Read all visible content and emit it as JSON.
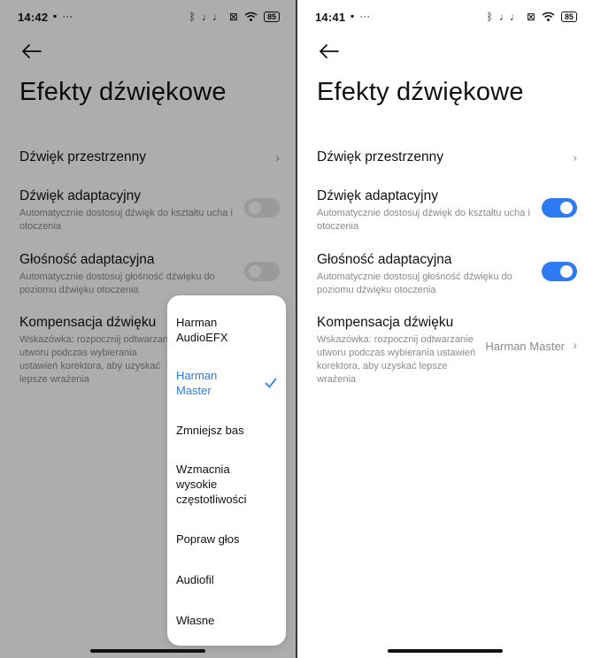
{
  "left": {
    "status": {
      "time": "14:42",
      "battery": "85"
    },
    "title": "Efekty dźwiękowe",
    "rows": {
      "spatial": {
        "title": "Dźwięk przestrzenny"
      },
      "adaptive_sound": {
        "title": "Dźwięk adaptacyjny",
        "desc": "Automatycznie dostosuj dźwięk do kształtu ucha i otoczenia",
        "on": false
      },
      "adaptive_volume": {
        "title": "Głośność adaptacyjna",
        "desc": "Automatycznie dostosuj głośność dźwięku do poziomu dźwięku otoczenia",
        "on": false
      },
      "compensation": {
        "title": "Kompensacja dźwięku",
        "desc": "Wskazówka: rozpocznij odtwarzanie utworu podczas wybierania ustawień korektora, aby uzyskać lepsze wrażenia"
      }
    },
    "menu": {
      "items": [
        {
          "label": "Harman AudioEFX",
          "selected": false
        },
        {
          "label": "Harman Master",
          "selected": true
        },
        {
          "label": "Zmniejsz bas",
          "selected": false
        },
        {
          "label": "Wzmacnia wysokie częstotliwości",
          "selected": false
        },
        {
          "label": "Popraw głos",
          "selected": false
        },
        {
          "label": "Audiofil",
          "selected": false
        },
        {
          "label": "Własne",
          "selected": false
        }
      ]
    }
  },
  "right": {
    "status": {
      "time": "14:41",
      "battery": "85"
    },
    "title": "Efekty dźwiękowe",
    "rows": {
      "spatial": {
        "title": "Dźwięk przestrzenny"
      },
      "adaptive_sound": {
        "title": "Dźwięk adaptacyjny",
        "desc": "Automatycznie dostosuj dźwięk do kształtu ucha i otoczenia",
        "on": true
      },
      "adaptive_volume": {
        "title": "Głośność adaptacyjna",
        "desc": "Automatycznie dostosuj głośność dźwięku do poziomu dźwięku otoczenia",
        "on": true
      },
      "compensation": {
        "title": "Kompensacja dźwięku",
        "desc": "Wskazówka: rozpocznij odtwarzanie utworu podczas wybierania ustawień korektora, aby uzyskać lepsze wrażenia",
        "value": "Harman Master"
      }
    }
  },
  "colors": {
    "accent": "#2e7af3",
    "toggle_off": "#e3e3e3",
    "text_secondary": "#8a8a8a"
  },
  "icons": {
    "back": "arrow-left-icon",
    "chevron": "chevron-right-icon",
    "check": "check-icon"
  }
}
